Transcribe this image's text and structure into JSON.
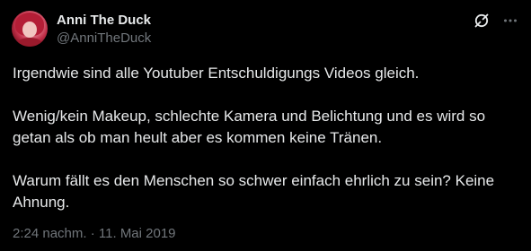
{
  "author": {
    "display_name": "Anni The Duck",
    "handle": "@AnniTheDuck"
  },
  "icons": {
    "grok": "grok-icon",
    "more": "more-options-icon",
    "avatar": "profile-picture"
  },
  "tweet": {
    "paragraphs": [
      "Irgendwie sind alle Youtuber Entschuldigungs Videos gleich.",
      "Wenig/kein Makeup, schlechte Kamera und Belichtung und es wird so getan als ob man heult aber es kommen keine Tränen.",
      "Warum fällt es den Menschen so schwer einfach ehrlich zu sein? Keine Ahnung."
    ]
  },
  "meta": {
    "time": "2:24 nachm.",
    "separator": "·",
    "date": "11. Mai 2019"
  },
  "colors": {
    "background": "#000000",
    "text": "#e7e9ea",
    "secondary": "#71767b"
  }
}
